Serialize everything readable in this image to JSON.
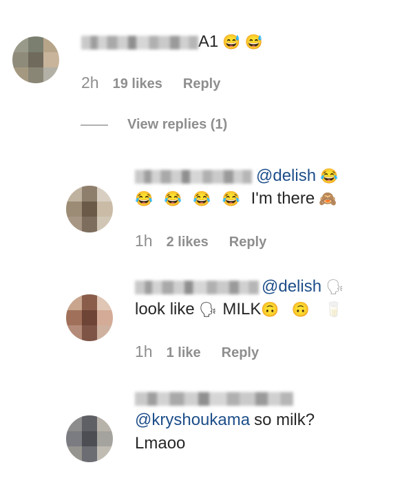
{
  "comments": [
    {
      "text_suffix": "A1",
      "emojis": [
        "😅",
        "😅"
      ],
      "time": "2h",
      "likes": "19 likes",
      "reply": "Reply",
      "avatar_colors": [
        "#9a9a8a",
        "#7a7f70",
        "#b7a58a",
        "#8f8b7a",
        "#6f6a5c",
        "#c7b49a",
        "#a49880",
        "#8a8676",
        "#b3b0a5"
      ]
    },
    {
      "mention": "@delish",
      "emoji_after_mention": "😂",
      "line2_emojis": [
        "😂",
        "😂",
        "😂",
        "😂"
      ],
      "line2_text": "I'm there",
      "line2_end_emoji": "🙈",
      "time": "1h",
      "likes": "2 likes",
      "reply": "Reply",
      "avatar_colors": [
        "#bfb29e",
        "#8e7f6c",
        "#d8cfc2",
        "#9c8b75",
        "#6b5a48",
        "#c9bba6",
        "#a89684",
        "#7d6d5c",
        "#d1c6b6"
      ]
    },
    {
      "mention": "@delish",
      "emoji_after_mention": "🗣",
      "line2_text_a": "look like",
      "line2_emoji_mid": "🗣",
      "line2_text_b": "MILK",
      "line2_emojis": [
        "🙃",
        "🙃",
        "🥛"
      ],
      "time": "1h",
      "likes": "1 like",
      "reply": "Reply",
      "avatar_colors": [
        "#c9a58e",
        "#8a5d4b",
        "#e0c6b5",
        "#a0705a",
        "#6d4436",
        "#d3ab96",
        "#b48b78",
        "#7e5446",
        "#cfb1a0"
      ]
    },
    {
      "mention": "@kryshoukama",
      "line1_text": "so milk?",
      "line2_text": "Lmaoo",
      "avatar_colors": [
        "#8c8c8c",
        "#5e6066",
        "#b8b3aa",
        "#7a7c82",
        "#4c4e54",
        "#a5a39d",
        "#96948e",
        "#6b6d73",
        "#c0bcb4"
      ]
    }
  ],
  "view_replies": "View replies (1)"
}
